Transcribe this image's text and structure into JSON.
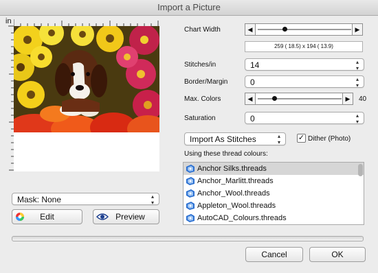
{
  "window": {
    "title": "Import a Picture"
  },
  "ruler": {
    "unit_label": "in"
  },
  "chart_width": {
    "label": "Chart Width",
    "value_text": "259 ( 18.5)  x 194 ( 13.9)",
    "position_fraction": 0.29
  },
  "stitches_per_in": {
    "label": "Stitches/in",
    "value": "14"
  },
  "border_margin": {
    "label": "Border/Margin",
    "value": "0"
  },
  "max_colors": {
    "label": "Max. Colors",
    "value": "40",
    "position_fraction": 0.2
  },
  "saturation": {
    "label": "Saturation",
    "value": "0"
  },
  "import_mode": {
    "value": "Import As Stitches"
  },
  "dither": {
    "label": "Dither (Photo)",
    "checked": true
  },
  "threads": {
    "heading": "Using these thread colours:",
    "items": [
      {
        "name": "Anchor Silks.threads",
        "selected": true
      },
      {
        "name": "Anchor_Marlitt.threads",
        "selected": false
      },
      {
        "name": "Anchor_Wool.threads",
        "selected": false
      },
      {
        "name": "Appleton_Wool.threads",
        "selected": false
      },
      {
        "name": "AutoCAD_Colours.threads",
        "selected": false
      }
    ]
  },
  "mask": {
    "value": "Mask: None"
  },
  "buttons": {
    "edit": "Edit",
    "preview": "Preview",
    "cancel": "Cancel",
    "ok": "OK"
  },
  "colors": {
    "accent_blue": "#2a6fd1",
    "window_bg": "#ececec"
  }
}
